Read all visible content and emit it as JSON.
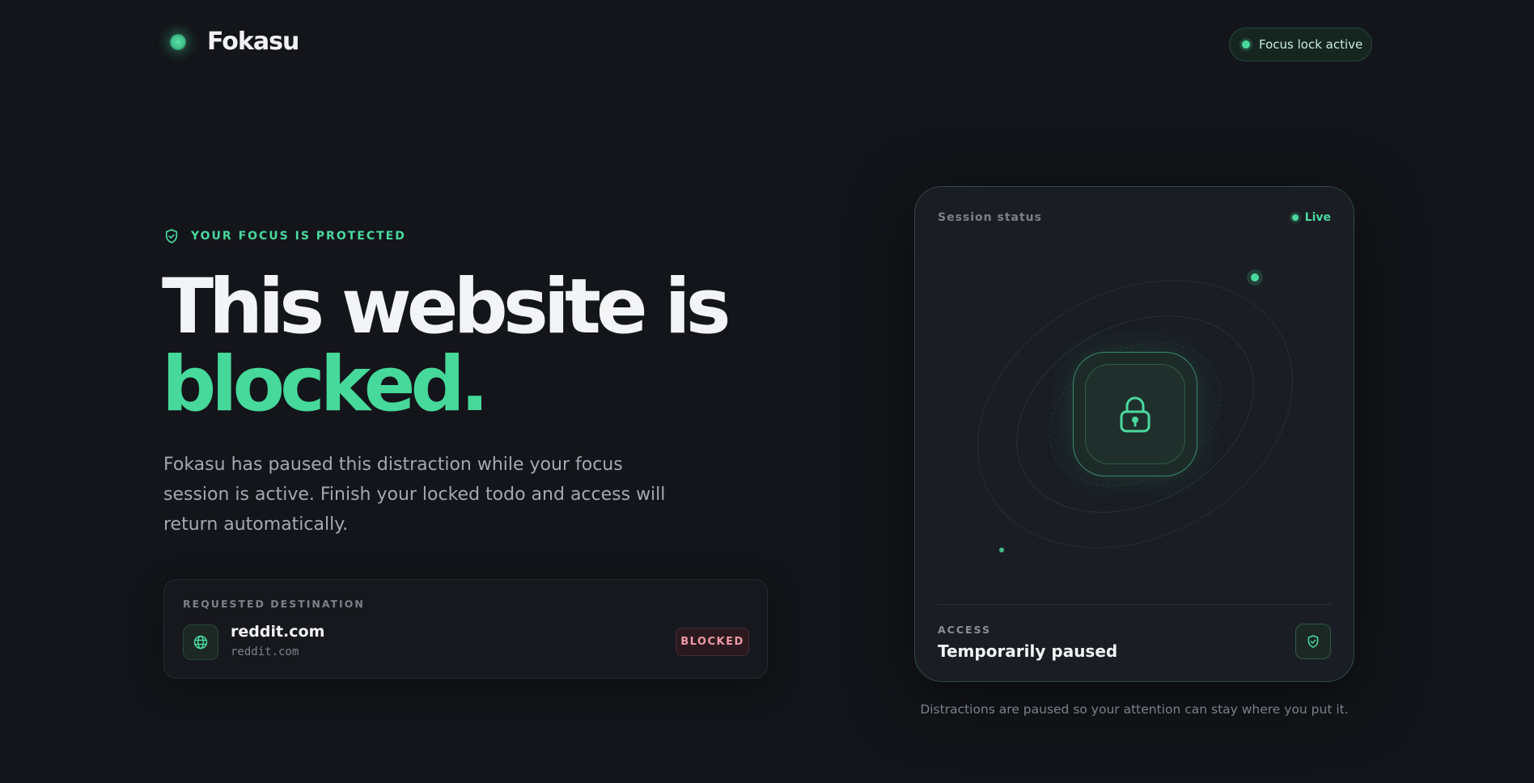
{
  "header": {
    "brand_name": "Fokasu",
    "status_pill": "Focus lock active"
  },
  "hero": {
    "eyebrow": "YOUR FOCUS IS PROTECTED",
    "headline_line1": "This website is",
    "headline_line2": "blocked.",
    "description": "Fokasu has paused this distraction while your focus session is active. Finish your locked todo and access will return automatically."
  },
  "destination": {
    "caption": "REQUESTED DESTINATION",
    "name": "reddit.com",
    "url": "reddit.com",
    "badge": "BLOCKED",
    "icon": "globe-icon"
  },
  "session": {
    "title": "Session status",
    "live_label": "Live",
    "center_icon": "lock-icon",
    "access_caption": "ACCESS",
    "access_value": "Temporarily paused",
    "access_icon": "shield-check-icon"
  },
  "footnote": "Distractions are paused so your attention can stay where you put it.",
  "colors": {
    "background": "#13151a",
    "accent": "#46d99b",
    "blocked": "#f09aa8"
  }
}
